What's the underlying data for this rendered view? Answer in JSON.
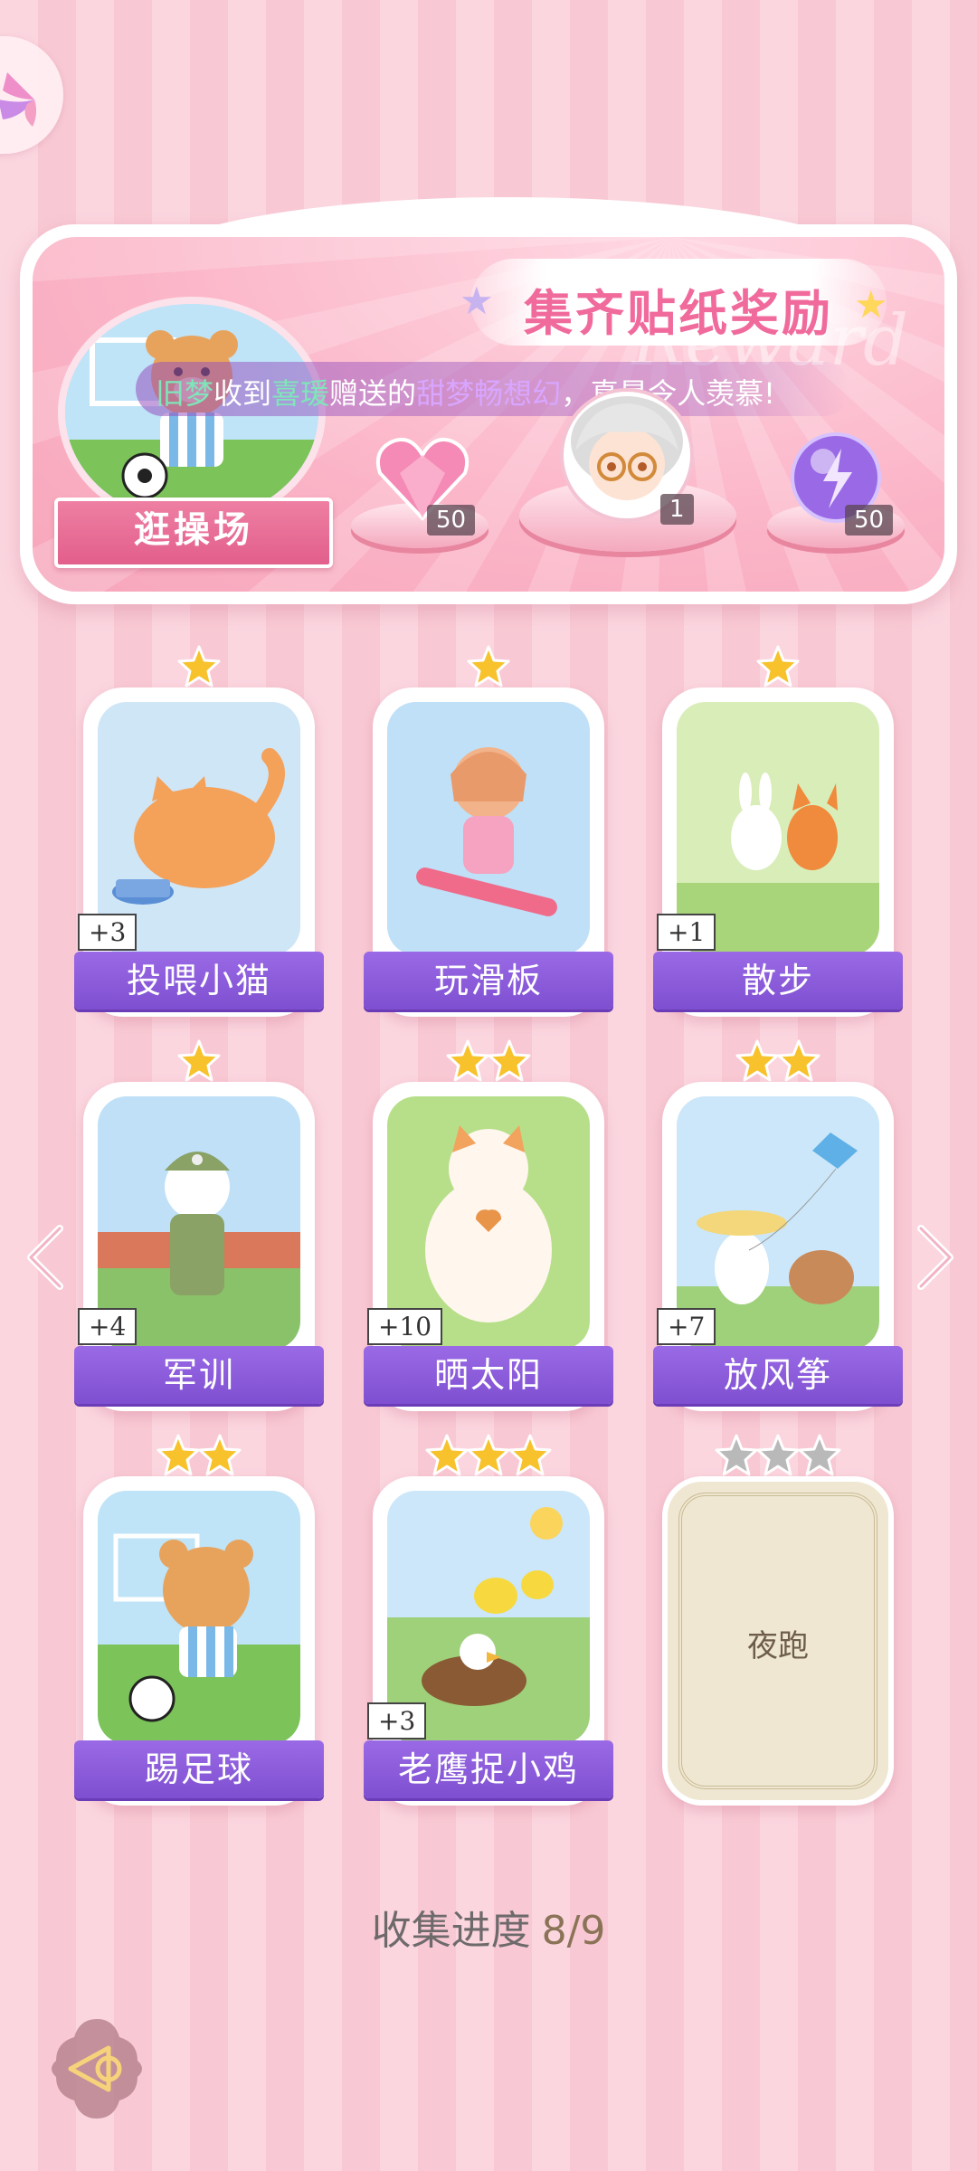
{
  "banner": {
    "title": "集齐贴纸奖励",
    "ghost_text": "Reward",
    "marquee": {
      "sender": "旧梦",
      "text1": "收到",
      "receiver": "喜瑗",
      "text2": "赠送的",
      "gift": "甜梦畅想幻",
      "text3": "，真是令人羡慕!"
    },
    "place_label": "逛操场",
    "rewards": [
      {
        "name": "pink-heart-gem",
        "count": "50"
      },
      {
        "name": "avatar-frame",
        "count": "1"
      },
      {
        "name": "energy-orb",
        "count": "50"
      }
    ]
  },
  "cards": [
    {
      "label": "投喂小猫",
      "stars": 1,
      "bonus": "+3",
      "scene": "cat",
      "unlocked": true
    },
    {
      "label": "玩滑板",
      "stars": 1,
      "bonus": "",
      "scene": "skate",
      "unlocked": true
    },
    {
      "label": "散步",
      "stars": 1,
      "bonus": "+1",
      "scene": "walk",
      "unlocked": true
    },
    {
      "label": "军训",
      "stars": 1,
      "bonus": "+4",
      "scene": "military",
      "unlocked": true
    },
    {
      "label": "晒太阳",
      "stars": 2,
      "bonus": "+10",
      "scene": "sun",
      "unlocked": true
    },
    {
      "label": "放风筝",
      "stars": 2,
      "bonus": "+7",
      "scene": "kite",
      "unlocked": true
    },
    {
      "label": "踢足球",
      "stars": 2,
      "bonus": "",
      "scene": "soccer",
      "unlocked": true
    },
    {
      "label": "老鹰捉小鸡",
      "stars": 3,
      "bonus": "+3",
      "scene": "eagle",
      "unlocked": true
    },
    {
      "label": "夜跑",
      "stars": 3,
      "bonus": "",
      "scene": "locked",
      "unlocked": false
    }
  ],
  "progress": {
    "label": "收集进度",
    "value": "8/9"
  },
  "colors": {
    "accent": "#8b5bdc",
    "star_gold": "#f7c22b",
    "star_gray": "#b9b9b9",
    "pink_bg": "#fbd6df"
  }
}
